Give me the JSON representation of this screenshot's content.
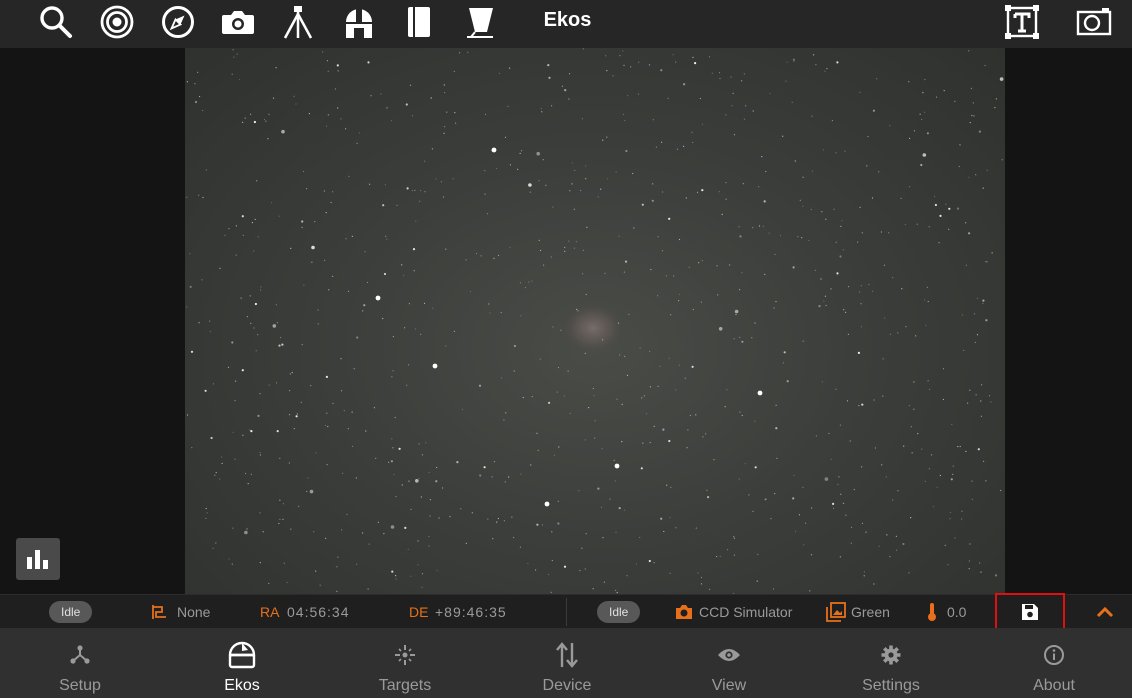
{
  "toolbar": {
    "title": "Ekos",
    "left_icons": [
      "search-icon",
      "target-icon",
      "compass-icon",
      "camera-icon",
      "tripod-icon",
      "observatory-icon",
      "notebook-icon",
      "flat-panel-icon"
    ],
    "right_icons": [
      "text-frame-icon",
      "viewfinder-icon"
    ]
  },
  "status": {
    "mount_state": "Idle",
    "track_target": "None",
    "ra_label": "RA",
    "ra_value": "04:56:34",
    "de_label": "DE",
    "de_value": "+89:46:35",
    "camera_state": "Idle",
    "camera_name": "CCD Simulator",
    "filter_name": "Green",
    "temperature": "0.0"
  },
  "nav": {
    "items": [
      {
        "label": "Setup",
        "icon": "setup-nodes-icon"
      },
      {
        "label": "Ekos",
        "icon": "observatory-dome-icon",
        "active": true
      },
      {
        "label": "Targets",
        "icon": "crosshair-icon"
      },
      {
        "label": "Device",
        "icon": "updown-arrows-icon"
      },
      {
        "label": "View",
        "icon": "eye-icon"
      },
      {
        "label": "Settings",
        "icon": "gear-icon"
      },
      {
        "label": "About",
        "icon": "info-icon"
      }
    ]
  },
  "colors": {
    "accent": "#e8701a",
    "highlight_border": "#e01010"
  }
}
